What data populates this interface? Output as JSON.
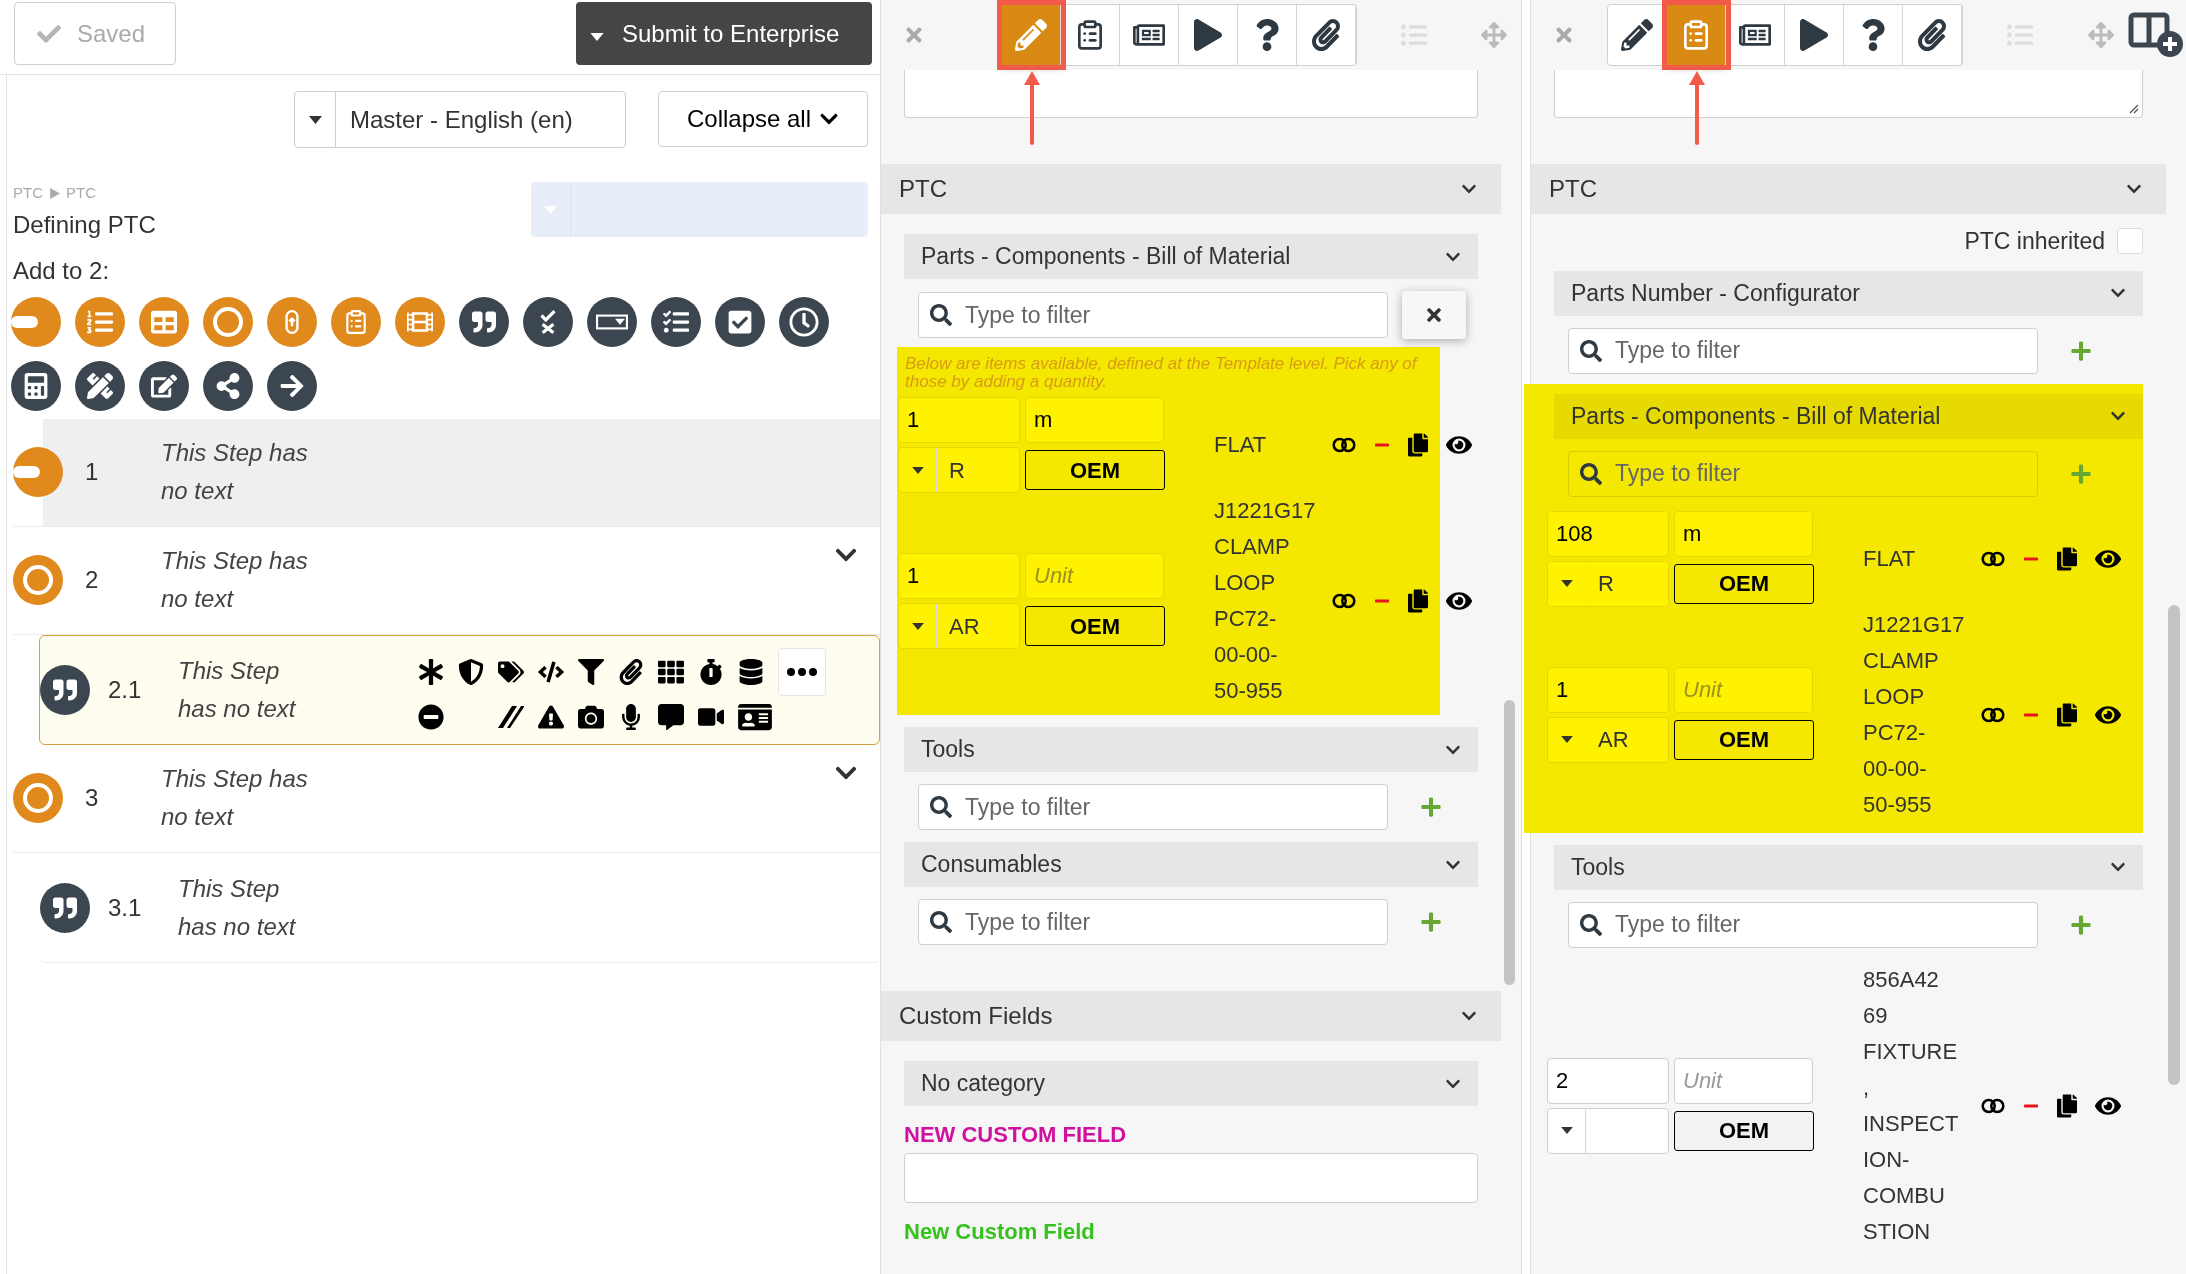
{
  "left": {
    "saved_button": "Saved",
    "submit_button": "Submit to Enterprise",
    "language_select": "Master - English (en)",
    "collapse_button": "Collapse all",
    "breadcrumb": [
      "PTC",
      "PTC"
    ],
    "title": "Defining PTC",
    "add_label": "Add to 2:",
    "add_icons": [
      {
        "kind": "unit",
        "color": "#e08a1e"
      },
      {
        "kind": "numbered-list",
        "color": "#e08a1e"
      },
      {
        "kind": "table",
        "color": "#e08a1e"
      },
      {
        "kind": "circle",
        "color": "#e08a1e"
      },
      {
        "kind": "loop",
        "color": "#e08a1e"
      },
      {
        "kind": "checklist",
        "color": "#e08a1e"
      },
      {
        "kind": "film",
        "color": "#e08a1e"
      },
      {
        "kind": "quote",
        "color": "#3c4650"
      },
      {
        "kind": "check-cross",
        "color": "#3c4650"
      },
      {
        "kind": "dropdown",
        "color": "#3c4650"
      },
      {
        "kind": "check-list",
        "color": "#3c4650"
      },
      {
        "kind": "checkbox",
        "color": "#3c4650"
      },
      {
        "kind": "clock",
        "color": "#3c4650"
      },
      {
        "kind": "calculator",
        "color": "#3c4650"
      },
      {
        "kind": "ruler-pencil",
        "color": "#3c4650"
      },
      {
        "kind": "edit",
        "color": "#3c4650"
      },
      {
        "kind": "share",
        "color": "#3c4650"
      },
      {
        "kind": "arrow",
        "color": "#3c4650"
      }
    ],
    "steps": [
      {
        "number": "1",
        "kind": "unit",
        "text_lines": [
          "This Step has",
          "no text"
        ],
        "selected": false,
        "highlighted": true
      },
      {
        "number": "2",
        "kind": "circle",
        "text_lines": [
          "This Step has",
          "no text"
        ],
        "selected": false,
        "highlighted": false,
        "expanded": true,
        "children": [
          {
            "number": "2.1",
            "kind": "quote",
            "text_lines": [
              "This Step",
              "has no text"
            ],
            "selected": true,
            "highlighted": false
          }
        ]
      },
      {
        "number": "3",
        "kind": "circle",
        "text_lines": [
          "This Step has",
          "no text"
        ],
        "selected": false,
        "highlighted": false,
        "expanded": true,
        "children": [
          {
            "number": "3.1",
            "kind": "quote",
            "text_lines": [
              "This Step",
              "has no text"
            ],
            "selected": false,
            "highlighted": false
          }
        ]
      }
    ]
  },
  "middle": {
    "toolbar": {
      "tools": [
        {
          "kind": "edit",
          "selected": true,
          "annotated": true
        },
        {
          "kind": "checklist",
          "selected": false,
          "annotated": false
        },
        {
          "kind": "form",
          "selected": false,
          "annotated": false
        },
        {
          "kind": "play",
          "selected": false,
          "annotated": false
        },
        {
          "kind": "help",
          "selected": false,
          "annotated": false
        },
        {
          "kind": "attach",
          "selected": false,
          "annotated": false
        }
      ]
    },
    "sections": [
      {
        "title": "PTC",
        "groups": [
          {
            "title": "Parts - Components - Bill of Material",
            "kind": "clear-filter",
            "highlighted": true,
            "header_highlighted": false,
            "filter_placeholder": "Type to filter",
            "note": "Below are items available, defined at the Template level. Pick any of those by adding a quantity.",
            "items": [
              {
                "quantity": "1",
                "unit": "m",
                "type": "R",
                "source": "OEM",
                "description_lines": [
                  "FLAT"
                ]
              },
              {
                "quantity": "1",
                "unit_placeholder": "Unit",
                "type": "AR",
                "source": "OEM",
                "description_lines": [
                  "J1221G17",
                  "CLAMP",
                  "LOOP",
                  "PC72-",
                  "00-00-",
                  "50-955"
                ]
              }
            ]
          },
          {
            "title": "Tools",
            "kind": "add-filter",
            "highlighted": false,
            "header_highlighted": false,
            "filter_placeholder": "Type to filter"
          },
          {
            "title": "Consumables",
            "kind": "add-filter",
            "highlighted": false,
            "header_highlighted": false,
            "filter_placeholder": "Type to filter"
          }
        ]
      },
      {
        "title": "Custom Fields",
        "groups": [
          {
            "title": "No category",
            "kind": "custom",
            "highlighted": false,
            "header_highlighted": false,
            "custom_fields": [
              {
                "label": "NEW CUSTOM FIELD",
                "kind": "field",
                "color": "#d0109e"
              },
              {
                "label": "New Custom Field",
                "kind": "label",
                "color": "#35c21e"
              }
            ]
          }
        ]
      }
    ]
  },
  "right": {
    "toolbar": {
      "tools": [
        {
          "kind": "edit",
          "selected": false,
          "annotated": false
        },
        {
          "kind": "checklist",
          "selected": true,
          "annotated": true
        },
        {
          "kind": "form",
          "selected": false,
          "annotated": false
        },
        {
          "kind": "play",
          "selected": false,
          "annotated": false
        },
        {
          "kind": "help",
          "selected": false,
          "annotated": false
        },
        {
          "kind": "attach",
          "selected": false,
          "annotated": false
        }
      ]
    },
    "sections": [
      {
        "title": "PTC",
        "inherited": {
          "label": "PTC inherited",
          "checked": false
        },
        "groups": [
          {
            "title": "Parts Number - Configurator",
            "kind": "add-filter",
            "highlighted": false,
            "header_highlighted": false,
            "filter_placeholder": "Type to filter"
          },
          {
            "title": "Parts - Components - Bill of Material",
            "kind": "add-filter",
            "highlighted": true,
            "header_highlighted": true,
            "filter_placeholder": "Type to filter",
            "items": [
              {
                "quantity": "108",
                "unit": "m",
                "type": "R",
                "source": "OEM",
                "description_lines": [
                  "FLAT"
                ]
              },
              {
                "quantity": "1",
                "unit_placeholder": "Unit",
                "type": "AR",
                "source": "OEM",
                "description_lines": [
                  "J1221G17",
                  "CLAMP",
                  "LOOP",
                  "PC72-",
                  "00-00-",
                  "50-955"
                ]
              }
            ]
          },
          {
            "title": "Tools",
            "kind": "add-filter",
            "highlighted": false,
            "header_highlighted": false,
            "filter_placeholder": "Type to filter",
            "items": [
              {
                "quantity": "2",
                "unit_placeholder": "Unit",
                "source": "OEM",
                "description_lines": [
                  "856A42",
                  "69",
                  "FIXTURE",
                  ",",
                  "INSPECT",
                  "ION-",
                  "COMBU",
                  "STION"
                ]
              }
            ]
          }
        ]
      }
    ]
  }
}
